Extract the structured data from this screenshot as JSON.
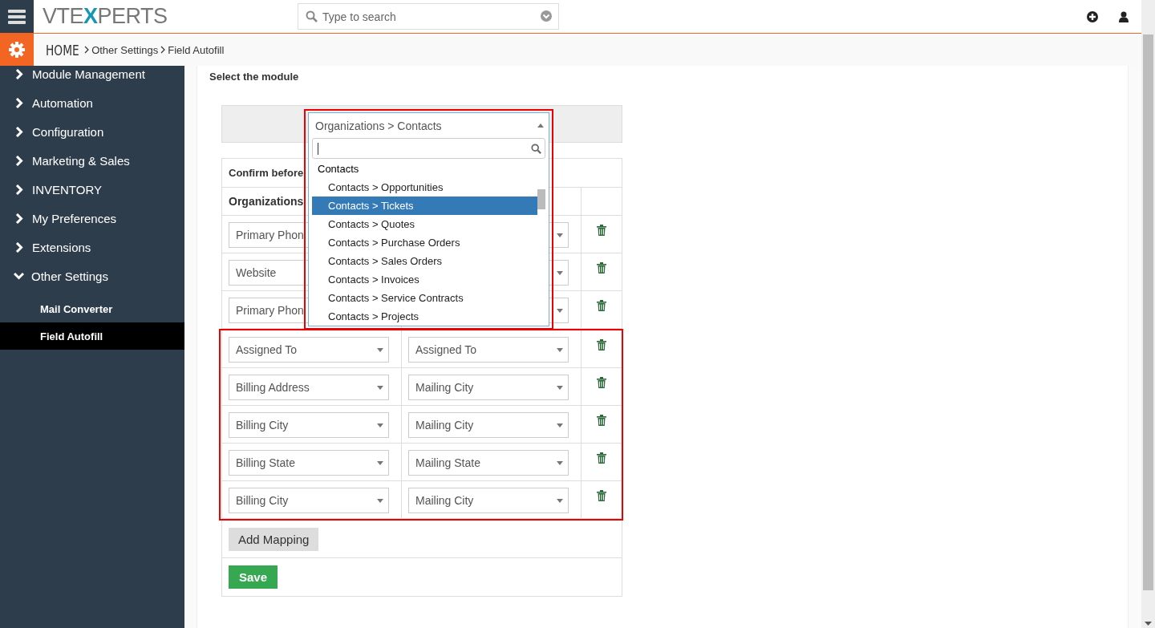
{
  "header": {
    "logo": {
      "before": "VTE",
      "mark": "X",
      "after": "PERTS"
    },
    "search": {
      "placeholder": "Type to search"
    }
  },
  "breadcrumb": [
    {
      "label": "HOME",
      "kind": "home"
    },
    {
      "label": "Other Settings",
      "kind": "link"
    },
    {
      "label": "Field Autofill",
      "kind": "current"
    }
  ],
  "sidebar": {
    "items": [
      {
        "label": "Module Management",
        "expanded": false
      },
      {
        "label": "Automation",
        "expanded": false
      },
      {
        "label": "Configuration",
        "expanded": false
      },
      {
        "label": "Marketing & Sales",
        "expanded": false
      },
      {
        "label": "INVENTORY",
        "expanded": false
      },
      {
        "label": "My Preferences",
        "expanded": false
      },
      {
        "label": "Extensions",
        "expanded": false
      },
      {
        "label": "Other Settings",
        "expanded": true,
        "children": [
          {
            "label": "Mail Converter",
            "selected": false
          },
          {
            "label": "Field Autofill",
            "selected": true
          }
        ]
      }
    ]
  },
  "content": {
    "section_title": "Select the module",
    "module_select": {
      "value": "Organizations > Contacts",
      "expanded": true,
      "highlighted": true,
      "options": [
        {
          "kind": "group",
          "label": "Contacts"
        },
        {
          "kind": "option",
          "label": "Contacts > Opportunities",
          "selected": false
        },
        {
          "kind": "option",
          "label": "Contacts > Tickets",
          "selected": true
        },
        {
          "kind": "option",
          "label": "Contacts > Quotes",
          "selected": false
        },
        {
          "kind": "option",
          "label": "Contacts > Purchase Orders",
          "selected": false
        },
        {
          "kind": "option",
          "label": "Contacts > Sales Orders",
          "selected": false
        },
        {
          "kind": "option",
          "label": "Contacts > Invoices",
          "selected": false
        },
        {
          "kind": "option",
          "label": "Contacts > Service Contracts",
          "selected": false
        },
        {
          "kind": "option",
          "label": "Contacts > Projects",
          "selected": false
        }
      ]
    },
    "table": {
      "note": "Confirm before",
      "columns": [
        "Organizations"
      ],
      "groups": [
        {
          "highlighted": false,
          "rows": [
            {
              "source": "Primary Phon"
            },
            {
              "source": "Website"
            },
            {
              "source": "Primary Phon"
            }
          ]
        },
        {
          "highlighted": true,
          "rows": [
            {
              "source": "Assigned To",
              "target": "Assigned To"
            },
            {
              "source": "Billing Address",
              "target": "Mailing City"
            },
            {
              "source": "Billing City",
              "target": "Mailing City"
            },
            {
              "source": "Billing State",
              "target": "Mailing State"
            },
            {
              "source": "Billing City",
              "target": "Mailing City"
            }
          ]
        }
      ]
    },
    "buttons": {
      "add": "Add Mapping",
      "save": "Save"
    }
  }
}
